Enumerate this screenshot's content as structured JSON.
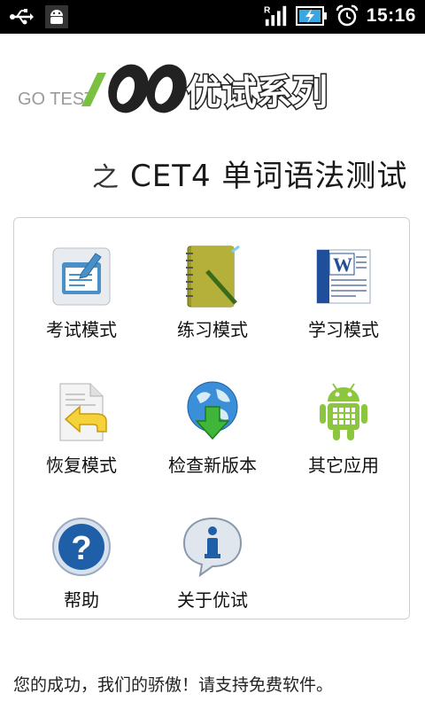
{
  "status_bar": {
    "time": "15:16",
    "roaming_indicator": "R",
    "icons": [
      "usb-icon",
      "android-debug-icon",
      "signal-icon",
      "battery-charging-icon",
      "alarm-icon"
    ]
  },
  "header": {
    "logo_text": "GO TEST",
    "series_name": "优试系列",
    "subtitle_prefix": "之",
    "subtitle": "CET4 单词语法测试"
  },
  "menu": {
    "items": [
      {
        "label": "考试模式",
        "icon": "exam-icon"
      },
      {
        "label": "练习模式",
        "icon": "notebook-icon"
      },
      {
        "label": "学习模式",
        "icon": "word-document-icon"
      },
      {
        "label": "恢复模式",
        "icon": "restore-icon"
      },
      {
        "label": "检查新版本",
        "icon": "globe-download-icon"
      },
      {
        "label": "其它应用",
        "icon": "android-icon"
      },
      {
        "label": "帮助",
        "icon": "help-icon"
      },
      {
        "label": "关于优试",
        "icon": "info-icon"
      }
    ]
  },
  "footer": {
    "text": "您的成功，我们的骄傲！请支持免费软件。"
  },
  "colors": {
    "status_bar_bg": "#000000",
    "panel_border": "#cfcfcf",
    "logo_green": "#7ac143",
    "logo_dark": "#222222"
  }
}
